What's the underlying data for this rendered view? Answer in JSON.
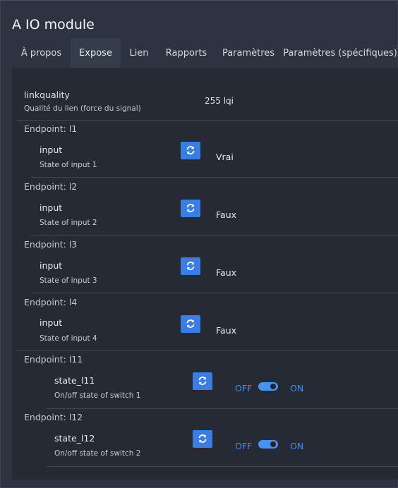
{
  "title": "A IO module",
  "tabs": [
    "À propos",
    "Expose",
    "Lien",
    "Rapports",
    "Paramètres",
    "Paramètres (spécifiques)"
  ],
  "linkquality": {
    "name": "linkquality",
    "description": "Qualité du lien (force du signal)",
    "value": "255 lqi"
  },
  "endpoints": [
    {
      "label": "Endpoint: l1",
      "name": "input",
      "description": "State of input 1",
      "value": "Vrai"
    },
    {
      "label": "Endpoint: l2",
      "name": "input",
      "description": "State of input 2",
      "value": "Faux"
    },
    {
      "label": "Endpoint: l3",
      "name": "input",
      "description": "State of input 3",
      "value": "Faux"
    },
    {
      "label": "Endpoint: l4",
      "name": "input",
      "description": "State of input 4",
      "value": "Faux"
    }
  ],
  "switches": [
    {
      "label": "Endpoint: l11",
      "name": "state_l11",
      "description": "On/off state of switch 1",
      "off_label": "OFF",
      "on_label": "ON",
      "state": "ON"
    },
    {
      "label": "Endpoint: l12",
      "name": "state_l12",
      "description": "On/off state of switch 2",
      "off_label": "OFF",
      "on_label": "ON",
      "state": "ON"
    }
  ],
  "colors": {
    "accent": "#3b7de0",
    "background": "#252a35",
    "toggle_label": "#3f8cff"
  },
  "icons": {
    "refresh": "refresh-icon"
  }
}
